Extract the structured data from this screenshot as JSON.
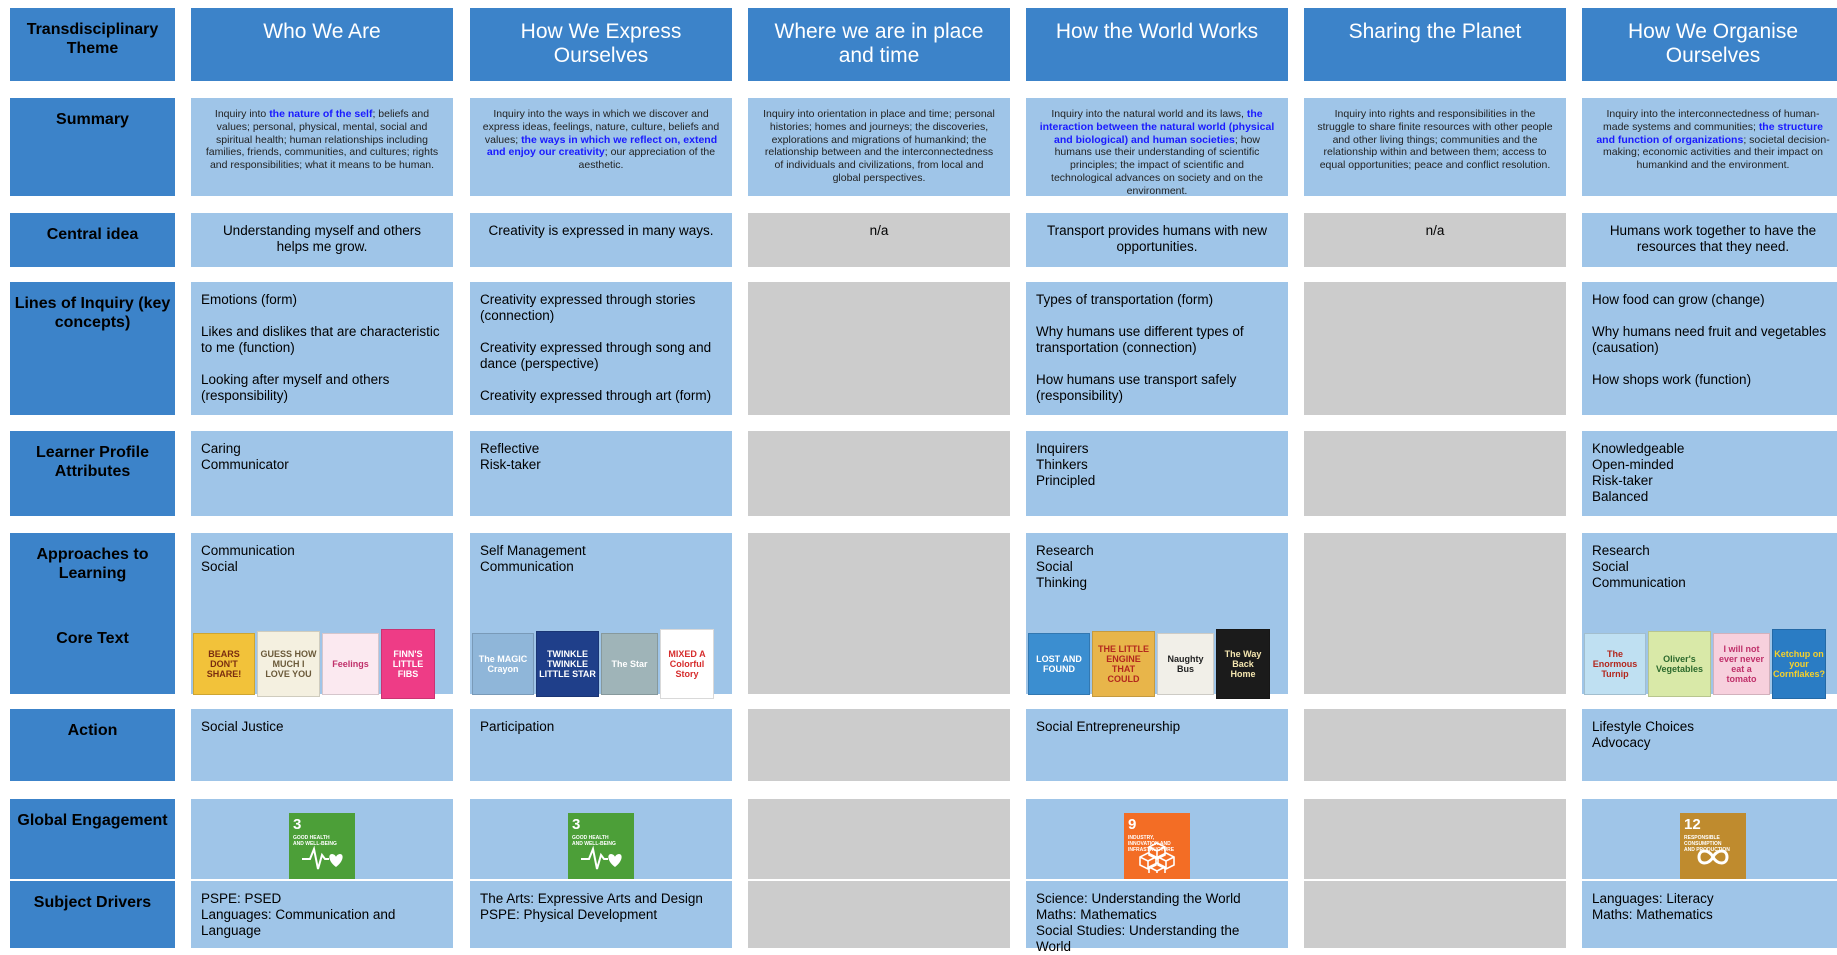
{
  "row_headers": {
    "theme": "Transdisciplinary Theme",
    "summary": "Summary",
    "central": "Central idea",
    "inquiry": "Lines of Inquiry (key concepts)",
    "profile": "Learner Profile Attributes",
    "approaches": "Approaches to Learning",
    "core": "Core Text",
    "action": "Action",
    "global": "Global Engagement",
    "subject": "Subject Drivers"
  },
  "themes": [
    {
      "title": "Who We Are",
      "summary": [
        "Inquiry into ",
        "the nature of the self",
        "; beliefs and values; personal, physical, mental, social and spiritual health; human relationships including families, friends, communities, and cultures; rights and responsibilities; what it means to be human."
      ],
      "central": "Understanding myself and others helps me grow.",
      "inquiry": [
        "Emotions (form)",
        "Likes and dislikes that are characteristic to me (function)",
        "Looking after myself and others (responsibility)"
      ],
      "profile": [
        "Caring",
        "Communicator"
      ],
      "approaches": [
        "Communication",
        "Social"
      ],
      "books": [
        {
          "title": "BEARS DON'T SHARE!",
          "bg": "#f2c23a",
          "fg": "#7a2d10"
        },
        {
          "title": "GUESS HOW MUCH I LOVE YOU",
          "bg": "#f4f0e0",
          "fg": "#6b5a3a"
        },
        {
          "title": "Feelings",
          "bg": "#fbe9f0",
          "fg": "#c0306a"
        },
        {
          "title": "FINN'S LITTLE FIBS",
          "bg": "#ee3c86",
          "fg": "#ffffff"
        }
      ],
      "action": [
        "Social Justice"
      ],
      "sdg": {
        "number": "3",
        "label": "GOOD HEALTH AND WELL-BEING",
        "color": "#4c9f38",
        "icon": "heartbeat-icon"
      },
      "subject": [
        "PSPE: PSED",
        "Languages: Communication and Language"
      ]
    },
    {
      "title": "How We Express Ourselves",
      "summary": [
        "Inquiry into the ways in which we discover and express ideas, feelings, nature, culture, beliefs and values; ",
        "the ways in which we reflect on, extend and enjoy our creativity",
        "; our appreciation of the aesthetic."
      ],
      "central": "Creativity is expressed in many ways.",
      "inquiry": [
        "Creativity expressed through stories (connection)",
        "Creativity expressed through song and dance (perspective)",
        "Creativity expressed through art (form)"
      ],
      "profile": [
        "Reflective",
        "Risk-taker"
      ],
      "approaches": [
        "Self Management",
        "Communication"
      ],
      "books": [
        {
          "title": "The MAGIC Crayon",
          "bg": "#8fb6d9",
          "fg": "#ffffff"
        },
        {
          "title": "TWINKLE TWINKLE LITTLE STAR",
          "bg": "#1f3f8a",
          "fg": "#ffffff"
        },
        {
          "title": "The Star",
          "bg": "#9fb4b8",
          "fg": "#ffffff"
        },
        {
          "title": "MIXED A Colorful Story",
          "bg": "#ffffff",
          "fg": "#d62d2d"
        }
      ],
      "action": [
        "Participation"
      ],
      "sdg": {
        "number": "3",
        "label": "GOOD HEALTH AND WELL-BEING",
        "color": "#4c9f38",
        "icon": "heartbeat-icon"
      },
      "subject": [
        "The Arts: Expressive Arts and Design",
        "PSPE: Physical Development"
      ]
    },
    {
      "title": "Where we are in place and time",
      "summary": [
        "Inquiry into orientation in place and time; personal histories; homes and journeys; the discoveries, explorations and migrations of humankind; the relationship between and the interconnectedness of individuals and civilizations, from local and global perspectives."
      ],
      "central": "n/a",
      "inquiry": [],
      "profile": [],
      "approaches": [],
      "books": [],
      "action": [],
      "sdg": null,
      "subject": []
    },
    {
      "title": "How the World Works",
      "summary": [
        "Inquiry into the natural world and its laws, ",
        "the interaction between the natural world (physical and biological) and human societies",
        "; how humans use their understanding of scientific principles; the impact of scientific and technological advances on society and on the environment."
      ],
      "central": "Transport provides humans with new opportunities.",
      "inquiry": [
        "Types of transportation (form)",
        "Why humans use different types of transportation (connection)",
        "How humans use transport safely (responsibility)"
      ],
      "profile": [
        "Inquirers",
        "Thinkers",
        "Principled"
      ],
      "approaches": [
        "Research",
        "Social",
        "Thinking"
      ],
      "books": [
        {
          "title": "LOST AND FOUND",
          "bg": "#3b8ed0",
          "fg": "#ffffff"
        },
        {
          "title": "THE LITTLE ENGINE THAT COULD",
          "bg": "#e8b54a",
          "fg": "#b3281e"
        },
        {
          "title": "Naughty Bus",
          "bg": "#f1efe8",
          "fg": "#222222"
        },
        {
          "title": "The Way Back Home",
          "bg": "#1b1b1b",
          "fg": "#f4e6b0"
        }
      ],
      "action": [
        "Social Entrepreneurship"
      ],
      "sdg": {
        "number": "9",
        "label": "INDUSTRY, INNOVATION AND INFRASTRUCTURE",
        "color": "#f36d25",
        "icon": "cubes-icon"
      },
      "subject": [
        "Science: Understanding the World",
        "Maths: Mathematics",
        "Social Studies: Understanding the World"
      ]
    },
    {
      "title": "Sharing the Planet",
      "summary": [
        "Inquiry into rights and responsibilities in the struggle to share finite resources with other people and other living things; communities and the relationship within and between them; access to equal opportunities; peace and conflict resolution."
      ],
      "central": "n/a",
      "inquiry": [],
      "profile": [],
      "approaches": [],
      "books": [],
      "action": [],
      "sdg": null,
      "subject": []
    },
    {
      "title": "How We Organise Ourselves",
      "summary": [
        "Inquiry into the interconnectedness of human-made systems and communities; ",
        "the structure and function of organizations",
        "; societal decision-making; economic activities and their impact on humankind and the environment."
      ],
      "central": "Humans work together to have the resources that they need.",
      "inquiry": [
        "How food can grow (change)",
        "Why humans need fruit and vegetables (causation)",
        "How shops work (function)"
      ],
      "profile": [
        "Knowledgeable",
        "Open-minded",
        "Risk-taker",
        "Balanced"
      ],
      "approaches": [
        "Research",
        "Social",
        "Communication"
      ],
      "books": [
        {
          "title": "The Enormous Turnip",
          "bg": "#bfe0f2",
          "fg": "#b3281e"
        },
        {
          "title": "Oliver's Vegetables",
          "bg": "#d9e9a8",
          "fg": "#2d6a2d"
        },
        {
          "title": "I will not ever never eat a tomato",
          "bg": "#f7d0dd",
          "fg": "#c0306a"
        },
        {
          "title": "Ketchup on your Cornflakes?",
          "bg": "#2a7cc4",
          "fg": "#f6d12b"
        }
      ],
      "action": [
        "Lifestyle Choices",
        "Advocacy"
      ],
      "sdg": {
        "number": "12",
        "label": "RESPONSIBLE CONSUMPTION AND PRODUCTION",
        "color": "#bf8b2e",
        "icon": "infinity-icon"
      },
      "subject": [
        "Languages: Literacy",
        "Maths: Mathematics"
      ]
    }
  ]
}
